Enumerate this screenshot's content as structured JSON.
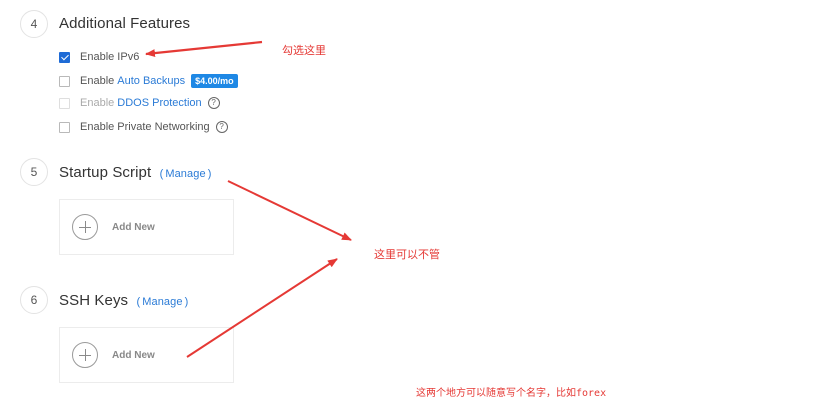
{
  "sections": {
    "additional": {
      "number": "4",
      "title": "Additional Features",
      "options": {
        "ipv6": {
          "label": "Enable IPv6",
          "checked": true
        },
        "backups": {
          "prefix": "Enable",
          "link": "Auto Backups",
          "badge": "$4.00/mo",
          "checked": false
        },
        "ddos": {
          "prefix": "Enable",
          "link": "DDOS Protection",
          "help": "?",
          "disabled": true
        },
        "private": {
          "label": "Enable Private Networking",
          "help": "?",
          "checked": false
        }
      }
    },
    "startup": {
      "number": "5",
      "title": "Startup Script",
      "paren_open": "(",
      "manage": "Manage",
      "paren_close": ")",
      "add_label": "Add New"
    },
    "ssh": {
      "number": "6",
      "title": "SSH Keys",
      "paren_open": "(",
      "manage": "Manage",
      "paren_close": ")",
      "add_label": "Add New"
    }
  },
  "annotations": {
    "check_here": "勾选这里",
    "ignore_here": "这里可以不管",
    "name_hint": "这两个地方可以随意写个名字，比如forex"
  },
  "colors": {
    "accent": "#1e6bd6",
    "link": "#2b7bd6",
    "annotation": "#e53935"
  }
}
